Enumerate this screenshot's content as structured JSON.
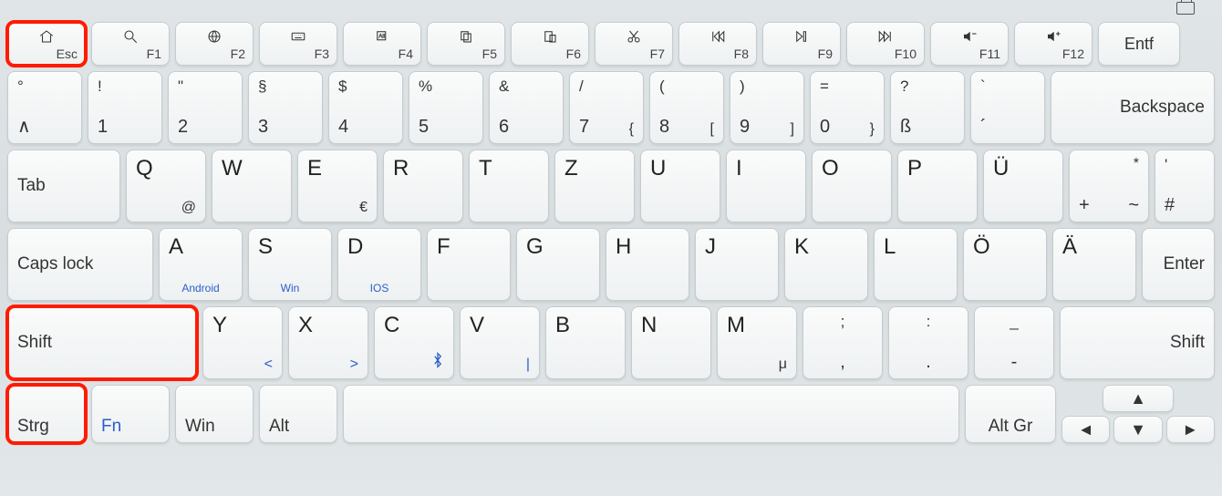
{
  "fn_row": {
    "esc": "Esc",
    "f1": "F1",
    "f2": "F2",
    "f3": "F3",
    "f4": "F4",
    "f5": "F5",
    "f6": "F6",
    "f7": "F7",
    "f8": "F8",
    "f9": "F9",
    "f10": "F10",
    "f11": "F11",
    "f12": "F12",
    "del": "Entf"
  },
  "num_row": {
    "k0": {
      "top": "°",
      "bot": "∧"
    },
    "k1": {
      "top": "!",
      "bot": "1"
    },
    "k2": {
      "top": "\"",
      "bot": "2"
    },
    "k3": {
      "top": "§",
      "bot": "3"
    },
    "k4": {
      "top": "$",
      "bot": "4"
    },
    "k5": {
      "top": "%",
      "bot": "5"
    },
    "k6": {
      "top": "&",
      "bot": "6"
    },
    "k7": {
      "top": "/",
      "bot": "7",
      "alt": "{"
    },
    "k8": {
      "top": "(",
      "bot": "8",
      "alt": "["
    },
    "k9": {
      "top": ")",
      "bot": "9",
      "alt": "]"
    },
    "k10": {
      "top": "=",
      "bot": "0",
      "alt": "}"
    },
    "k11": {
      "top": "?",
      "bot": "ß"
    },
    "k12": {
      "top": "`",
      "bot": "´"
    },
    "backspace": "Backspace"
  },
  "qw_row": {
    "tab": "Tab",
    "q": {
      "l": "Q",
      "alt": "@"
    },
    "w": {
      "l": "W"
    },
    "e": {
      "l": "E",
      "alt": "€"
    },
    "r": {
      "l": "R"
    },
    "t": {
      "l": "T"
    },
    "z": {
      "l": "Z"
    },
    "u": {
      "l": "U"
    },
    "i": {
      "l": "I"
    },
    "o": {
      "l": "O"
    },
    "p": {
      "l": "P"
    },
    "ue": {
      "l": "Ü"
    },
    "plus": {
      "top": "*",
      "botL": "+",
      "botR": "~"
    },
    "hash": {
      "top": "'",
      "bot": "#"
    }
  },
  "caps_row": {
    "caps": "Caps lock",
    "a": {
      "l": "A",
      "sub": "Android"
    },
    "s": {
      "l": "S",
      "sub": "Win"
    },
    "d": {
      "l": "D",
      "sub": "IOS"
    },
    "f": {
      "l": "F"
    },
    "g": {
      "l": "G"
    },
    "h": {
      "l": "H"
    },
    "j": {
      "l": "J"
    },
    "k": {
      "l": "K"
    },
    "l": {
      "l": "L"
    },
    "oe": {
      "l": "Ö"
    },
    "ae": {
      "l": "Ä"
    },
    "enter": "Enter"
  },
  "shift_row": {
    "lshift": "Shift",
    "y": {
      "l": "Y",
      "alt": "<"
    },
    "x": {
      "l": "X",
      "alt": ">"
    },
    "c": {
      "l": "C",
      "alt": "bt"
    },
    "v": {
      "l": "V",
      "alt": "|"
    },
    "b": {
      "l": "B"
    },
    "n": {
      "l": "N"
    },
    "m": {
      "l": "M",
      "alt": "μ",
      "altblack": true
    },
    "comma": {
      "top": ";",
      "bot": ",",
      "alt": ";"
    },
    "period": {
      "top": ":",
      "bot": ".",
      "alt": ":"
    },
    "dash": {
      "top": "_",
      "bot": "-"
    },
    "rshift": "Shift"
  },
  "space_row": {
    "strg": "Strg",
    "fn": "Fn",
    "win": "Win",
    "alt": "Alt",
    "altgr": "Alt Gr",
    "up": "▲",
    "down": "▼",
    "left": "◄",
    "right": "►"
  }
}
